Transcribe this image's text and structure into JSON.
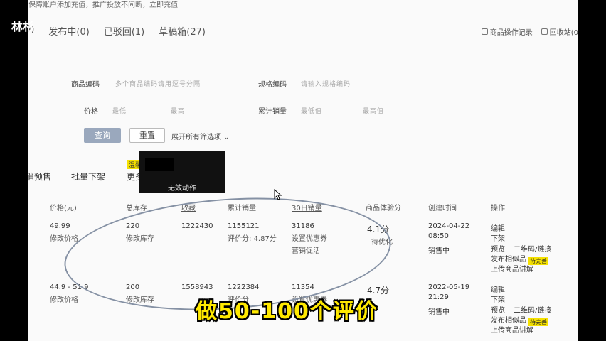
{
  "overlay": {
    "corner_tag": "林杉",
    "top_note": "保障账户添加充值，推广投放不间断，立即充值",
    "caption": "做50-100个评价"
  },
  "tabs": [
    {
      "label": "(0)"
    },
    {
      "label": "发布中(0)"
    },
    {
      "label": "已驳回(1)"
    },
    {
      "label": "草稿箱(27)"
    }
  ],
  "top_links": {
    "log": "商品操作记录",
    "recycle": "回收站(0"
  },
  "filters": {
    "product_code_label": "商品编码",
    "product_code_placeholder": "多个商品编码请用逗号分隔",
    "spec_code_label": "规格编码",
    "spec_code_placeholder": "请输入规格编码",
    "price_label": "价格",
    "price_min": "最低",
    "price_max": "最高",
    "sales_label": "累计销量",
    "sales_min": "最低值",
    "sales_max": "最高值",
    "query": "查询",
    "reset": "重置",
    "expand": "展开所有筛选项"
  },
  "actions": {
    "presale": "消预售",
    "bulk_off": "批量下架",
    "more": "更多",
    "tip": "温馨",
    "tooltip": "无效动作"
  },
  "table": {
    "headers": {
      "price": "价格(元)",
      "stock": "总库存",
      "favs": "收藏",
      "sales": "累计销量",
      "sales30": "30日销量",
      "exp": "商品体验分",
      "created": "创建时间",
      "ops": "操作"
    },
    "rows": [
      {
        "price": "49.99",
        "edit_price": "修改价格",
        "stock": "220",
        "edit_stock": "修改库存",
        "favs": "1222430",
        "sales": "1155121",
        "rating": "评价分: 4.87分",
        "sales30": "31186",
        "coupon": "设置优惠券",
        "promo": "营销促活",
        "score": "4.1分",
        "score_note": "待优化",
        "date": "2024-04-22",
        "time": "08:50",
        "status": "销售中",
        "op_edit": "编辑",
        "op_off": "下架",
        "op_preview": "预览",
        "op_qr": "二维码/链接",
        "op_similar": "发布相似品",
        "op_video": "上传商品讲解",
        "badge": "待完善"
      },
      {
        "price": "44.9 - 51.9",
        "edit_price": "修改价格",
        "stock": "200",
        "edit_stock": "修改库存",
        "favs": "1558943",
        "sales": "1222384",
        "rating": "评价分",
        "sales30": "11354",
        "coupon": "设置优惠券",
        "promo": "",
        "score": "4.7分",
        "score_note": "",
        "date": "2022-05-19",
        "time": "21:29",
        "status": "销售中",
        "op_edit": "编辑",
        "op_off": "下架",
        "op_preview": "预览",
        "op_qr": "二维码/链接",
        "op_similar": "发布相似品",
        "op_video": "上传商品讲解",
        "badge": "待完善"
      }
    ]
  }
}
